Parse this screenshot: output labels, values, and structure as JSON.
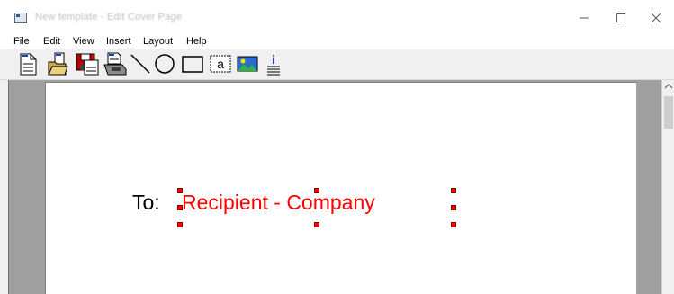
{
  "window": {
    "title": "New template - Edit Cover Page",
    "minimize_glyph": "—",
    "maximize_glyph": "☐",
    "close_glyph": "✕"
  },
  "menu": [
    "File",
    "Edit",
    "View",
    "Insert",
    "Layout",
    "Help"
  ],
  "toolbar": {
    "buttons": [
      {
        "name": "new-document-icon"
      },
      {
        "name": "open-folder-icon"
      },
      {
        "name": "save-icon"
      },
      {
        "name": "fax-machine-icon"
      },
      {
        "name": "line-tool-icon"
      },
      {
        "name": "ellipse-tool-icon"
      },
      {
        "name": "rectangle-tool-icon"
      },
      {
        "name": "text-tool-icon",
        "glyph": "a"
      },
      {
        "name": "image-tool-icon"
      },
      {
        "name": "info-field-icon",
        "glyph": "i"
      }
    ]
  },
  "canvas": {
    "label": "To:",
    "field": "Recipient - Company",
    "label_color": "#000000",
    "field_color": "#ff0000",
    "handle_color": "#ff0000"
  }
}
